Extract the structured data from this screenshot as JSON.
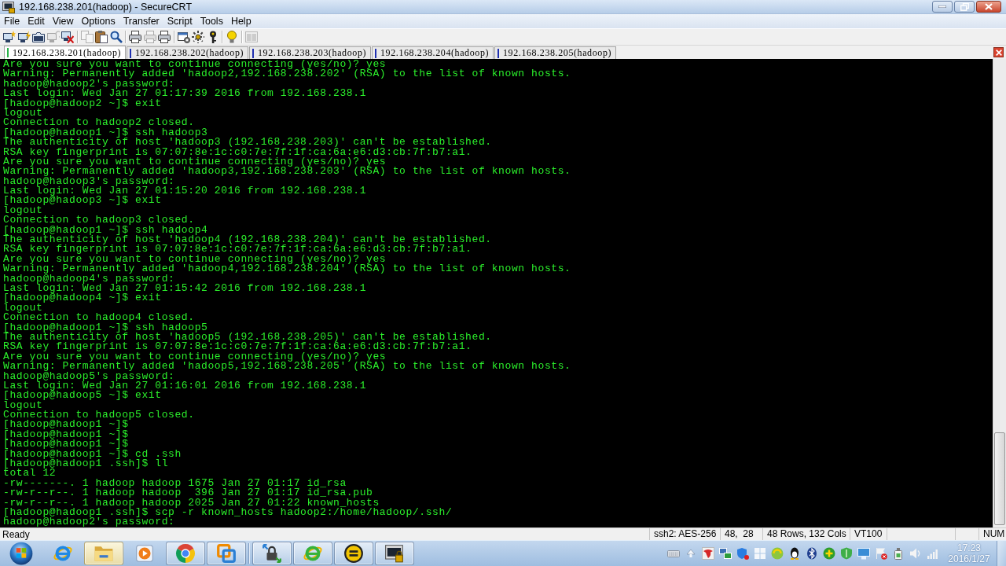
{
  "window": {
    "title": "192.168.238.201(hadoop) - SecureCRT"
  },
  "menu": [
    "File",
    "Edit",
    "View",
    "Options",
    "Transfer",
    "Script",
    "Tools",
    "Help"
  ],
  "toolbar": [
    {
      "buttons": [
        {
          "kind": "connect",
          "disabled": false
        },
        {
          "kind": "quickconnect",
          "disabled": false
        },
        {
          "kind": "tabconnect",
          "disabled": false
        },
        {
          "kind": "reconnect",
          "disabled": true
        },
        {
          "kind": "disconnect",
          "disabled": false
        }
      ]
    },
    {
      "buttons": [
        {
          "kind": "copy",
          "disabled": true
        },
        {
          "kind": "paste",
          "disabled": false
        },
        {
          "kind": "find",
          "disabled": false
        }
      ]
    },
    {
      "buttons": [
        {
          "kind": "printscreen",
          "disabled": false
        },
        {
          "kind": "printselection",
          "disabled": true
        },
        {
          "kind": "print",
          "disabled": false
        }
      ]
    },
    {
      "buttons": [
        {
          "kind": "session",
          "disabled": false
        },
        {
          "kind": "options",
          "disabled": false
        },
        {
          "kind": "keymap",
          "disabled": false
        }
      ]
    },
    {
      "buttons": [
        {
          "kind": "help",
          "disabled": false
        }
      ]
    },
    {
      "buttons": [
        {
          "kind": "tile",
          "disabled": true
        }
      ]
    }
  ],
  "tabs": [
    {
      "label": "192.168.238.201(hadoop)",
      "selected": true,
      "color": "#2bb34a"
    },
    {
      "label": "192.168.238.202(hadoop)",
      "selected": false,
      "color": "#1f2fb0"
    },
    {
      "label": "192.168.238.203(hadoop)",
      "selected": false,
      "color": "#1f2fb0"
    },
    {
      "label": "192.168.238.204(hadoop)",
      "selected": false,
      "color": "#1f2fb0"
    },
    {
      "label": "192.168.238.205(hadoop)",
      "selected": false,
      "color": "#1f2fb0"
    }
  ],
  "terminal": {
    "lines": [
      "Are you sure you want to continue connecting (yes/no)? yes",
      "Warning: Permanently added 'hadoop2,192.168.238.202' (RSA) to the list of known hosts.",
      "hadoop@hadoop2's password:",
      "Last login: Wed Jan 27 01:17:39 2016 from 192.168.238.1",
      "[hadoop@hadoop2 ~]$ exit",
      "logout",
      "Connection to hadoop2 closed.",
      "[hadoop@hadoop1 ~]$ ssh hadoop3",
      "The authenticity of host 'hadoop3 (192.168.238.203)' can't be established.",
      "RSA key fingerprint is 07:07:8e:1c:c0:7e:7f:1f:ca:6a:e6:d3:cb:7f:b7:a1.",
      "Are you sure you want to continue connecting (yes/no)? yes",
      "Warning: Permanently added 'hadoop3,192.168.238.203' (RSA) to the list of known hosts.",
      "hadoop@hadoop3's password:",
      "Last login: Wed Jan 27 01:15:20 2016 from 192.168.238.1",
      "[hadoop@hadoop3 ~]$ exit",
      "logout",
      "Connection to hadoop3 closed.",
      "[hadoop@hadoop1 ~]$ ssh hadoop4",
      "The authenticity of host 'hadoop4 (192.168.238.204)' can't be established.",
      "RSA key fingerprint is 07:07:8e:1c:c0:7e:7f:1f:ca:6a:e6:d3:cb:7f:b7:a1.",
      "Are you sure you want to continue connecting (yes/no)? yes",
      "Warning: Permanently added 'hadoop4,192.168.238.204' (RSA) to the list of known hosts.",
      "hadoop@hadoop4's password:",
      "Last login: Wed Jan 27 01:15:42 2016 from 192.168.238.1",
      "[hadoop@hadoop4 ~]$ exit",
      "logout",
      "Connection to hadoop4 closed.",
      "[hadoop@hadoop1 ~]$ ssh hadoop5",
      "The authenticity of host 'hadoop5 (192.168.238.205)' can't be established.",
      "RSA key fingerprint is 07:07:8e:1c:c0:7e:7f:1f:ca:6a:e6:d3:cb:7f:b7:a1.",
      "Are you sure you want to continue connecting (yes/no)? yes",
      "Warning: Permanently added 'hadoop5,192.168.238.205' (RSA) to the list of known hosts.",
      "hadoop@hadoop5's password:",
      "Last login: Wed Jan 27 01:16:01 2016 from 192.168.238.1",
      "[hadoop@hadoop5 ~]$ exit",
      "logout",
      "Connection to hadoop5 closed.",
      "[hadoop@hadoop1 ~]$",
      "[hadoop@hadoop1 ~]$",
      "[hadoop@hadoop1 ~]$",
      "[hadoop@hadoop1 ~]$ cd .ssh",
      "[hadoop@hadoop1 .ssh]$ ll",
      "total 12",
      "-rw-------. 1 hadoop hadoop 1675 Jan 27 01:17 id_rsa",
      "-rw-r--r--. 1 hadoop hadoop  396 Jan 27 01:17 id_rsa.pub",
      "-rw-r--r--. 1 hadoop hadoop 2025 Jan 27 01:22 known_hosts",
      "[hadoop@hadoop1 .ssh]$ scp -r known_hosts hadoop2:/home/hadoop/.ssh/",
      "hadoop@hadoop2's password:"
    ]
  },
  "status_bar": {
    "message": "Ready",
    "cells": [
      "ssh2: AES-256",
      "48,  28",
      "48 Rows, 132 Cols",
      "VT100"
    ],
    "indicators": [
      "NUM"
    ]
  },
  "taskbar": {
    "groups": [
      {
        "buttons": [
          {
            "kind": "ie",
            "running": false,
            "highlighted": false
          },
          {
            "kind": "folder",
            "running": true,
            "highlighted": true
          },
          {
            "kind": "media",
            "running": false,
            "highlighted": false
          },
          {
            "kind": "chrome",
            "running": true,
            "highlighted": false
          },
          {
            "kind": "vmware",
            "running": true,
            "highlighted": false
          }
        ]
      },
      {
        "buttons": [
          {
            "kind": "lock",
            "running": true,
            "highlighted": false
          },
          {
            "kind": "ie2",
            "running": true,
            "highlighted": false
          },
          {
            "kind": "ue",
            "running": true,
            "highlighted": false
          },
          {
            "kind": "securecrt",
            "running": true,
            "highlighted": false
          }
        ]
      }
    ],
    "clock": {
      "time": "17:23",
      "date": "2016/1/27"
    }
  }
}
